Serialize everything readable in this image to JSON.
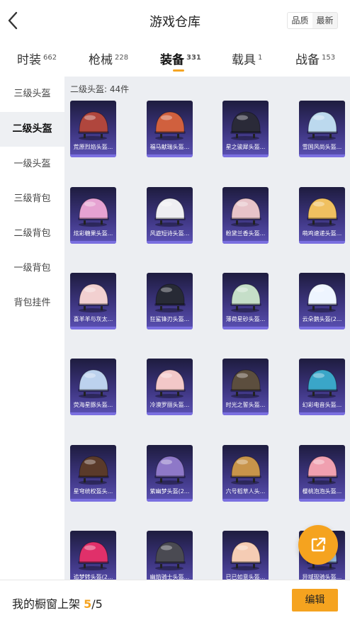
{
  "header": {
    "title": "游戏仓库",
    "back_icon": "chevron-left-icon",
    "sort_options": [
      "品质",
      "最新"
    ],
    "sort_selected": "品质"
  },
  "tabs": [
    {
      "label": "时装",
      "count": "662"
    },
    {
      "label": "枪械",
      "count": "228"
    },
    {
      "label": "装备",
      "count": "331"
    },
    {
      "label": "载具",
      "count": "1"
    },
    {
      "label": "战备",
      "count": "153"
    }
  ],
  "sidebar": {
    "items": [
      {
        "label": "三级头盔"
      },
      {
        "label": "二级头盔"
      },
      {
        "label": "一级头盔"
      },
      {
        "label": "三级背包"
      },
      {
        "label": "二级背包"
      },
      {
        "label": "一级背包"
      },
      {
        "label": "背包挂件"
      }
    ]
  },
  "section": {
    "title": "二级头盔: 44件"
  },
  "items": [
    {
      "name": "荒原烈焰头盔..."
    },
    {
      "name": "福马献瑞头盔..."
    },
    {
      "name": "星之骏犀头盔..."
    },
    {
      "name": "雪国风尚头盔..."
    },
    {
      "name": "炫彩糖果头盔..."
    },
    {
      "name": "风遊短诗头盔..."
    },
    {
      "name": "粉黛兰香头盔..."
    },
    {
      "name": "萌鸡速递头盔..."
    },
    {
      "name": "喜羊羊与灰太..."
    },
    {
      "name": "狂鲨锋刃头盔..."
    },
    {
      "name": "薄荷星砂头盔..."
    },
    {
      "name": "云朵鹅头盔(2..."
    },
    {
      "name": "荧海星豚头盔..."
    },
    {
      "name": "冷漠罗丽头盔..."
    },
    {
      "name": "时光之誓头盔..."
    },
    {
      "name": "幻彩电音头盔..."
    },
    {
      "name": "星穹统权盔头..."
    },
    {
      "name": "紫幽梦头盔(2..."
    },
    {
      "name": "六号稻草人头..."
    },
    {
      "name": "樱桃泡泡头盔..."
    },
    {
      "name": "追梦转头盔(2..."
    },
    {
      "name": "幽焰骑士头盔..."
    },
    {
      "name": "已已如意头盔..."
    },
    {
      "name": "异域现骑头盔..."
    }
  ],
  "item_colors": [
    "#b0463d",
    "#d0603e",
    "#2a2a38",
    "#bcd9ee",
    "#e6a2d2",
    "#eeeef2",
    "#e7c3c9",
    "#f0c060",
    "#f2d0d0",
    "#272a35",
    "#c5dec8",
    "#eef5ff",
    "#bcd2ee",
    "#f3c8c8",
    "#5c4e3e",
    "#3aa6c8",
    "#5a3a2a",
    "#8e78c8",
    "#c8944a",
    "#f0a0b0",
    "#e0306a",
    "#4a4a52",
    "#f5ccb4",
    "#9ac0e8"
  ],
  "bottom_bar": {
    "label": "我的橱窗上架 ",
    "current": "5",
    "total": "/5",
    "edit_label": "编辑"
  },
  "fab": {
    "icon": "share-icon"
  },
  "colors": {
    "accent": "#f5a31f",
    "card_top": "#1e1c3f",
    "card_bottom": "#5b51b4"
  }
}
